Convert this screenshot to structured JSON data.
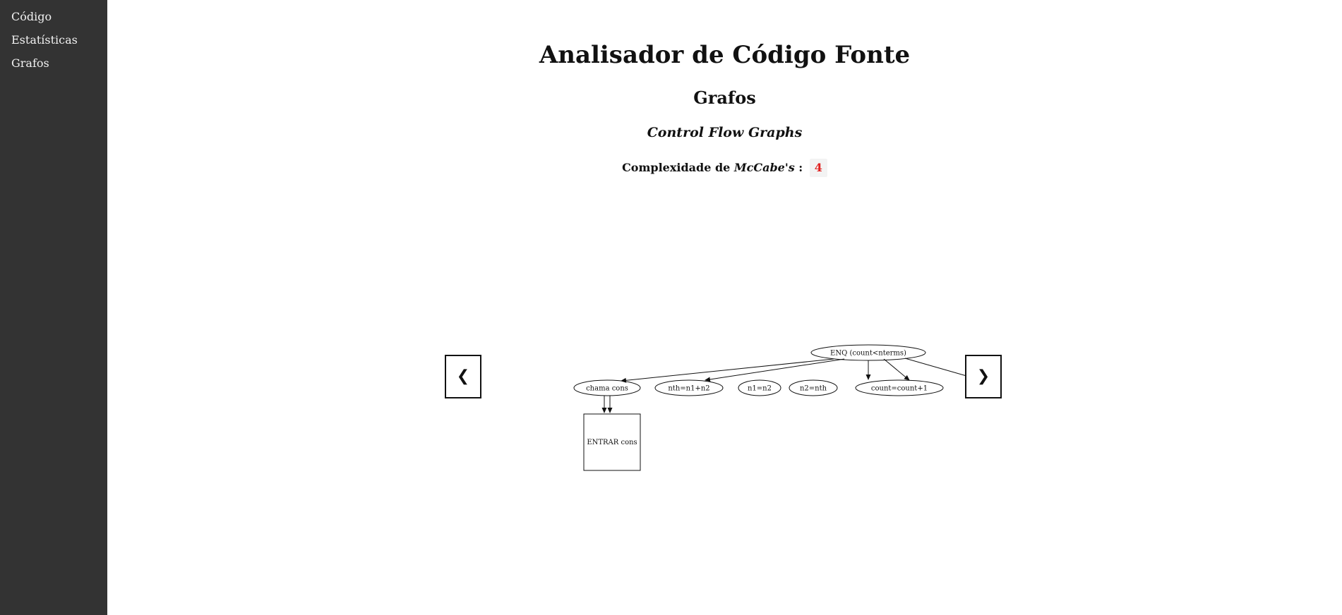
{
  "sidebar": {
    "items": [
      {
        "label": "Código"
      },
      {
        "label": "Estatísticas"
      },
      {
        "label": "Grafos"
      }
    ]
  },
  "header": {
    "title": "Analisador de Código Fonte"
  },
  "section": {
    "title": "Grafos",
    "subtitle": "Control Flow Graphs"
  },
  "complexity": {
    "label_prefix": "Complexidade de ",
    "label_name": "McCabe's",
    "label_suffix": " :",
    "value": "4"
  },
  "navigation": {
    "prev_label": "❮",
    "next_label": "❯"
  },
  "graph": {
    "nodes": [
      {
        "id": "enq",
        "label": "ENQ (count<nterms)",
        "shape": "ellipse"
      },
      {
        "id": "chama",
        "label": "chama cons",
        "shape": "ellipse"
      },
      {
        "id": "nth",
        "label": "nth=n1+n2",
        "shape": "ellipse"
      },
      {
        "id": "n1",
        "label": "n1=n2",
        "shape": "ellipse"
      },
      {
        "id": "n2",
        "label": "n2=nth",
        "shape": "ellipse"
      },
      {
        "id": "count",
        "label": "count=count+1",
        "shape": "ellipse"
      },
      {
        "id": "entrar",
        "label": "ENTRAR cons",
        "shape": "box"
      }
    ],
    "edges": [
      {
        "from": "enq",
        "to": "chama"
      },
      {
        "from": "enq",
        "to": "nth"
      },
      {
        "from": "enq",
        "to": "n1"
      },
      {
        "from": "enq",
        "to": "n2"
      },
      {
        "from": "enq",
        "to": "count"
      },
      {
        "from": "chama",
        "to": "entrar"
      },
      {
        "from": "chama",
        "to": "entrar"
      }
    ]
  }
}
